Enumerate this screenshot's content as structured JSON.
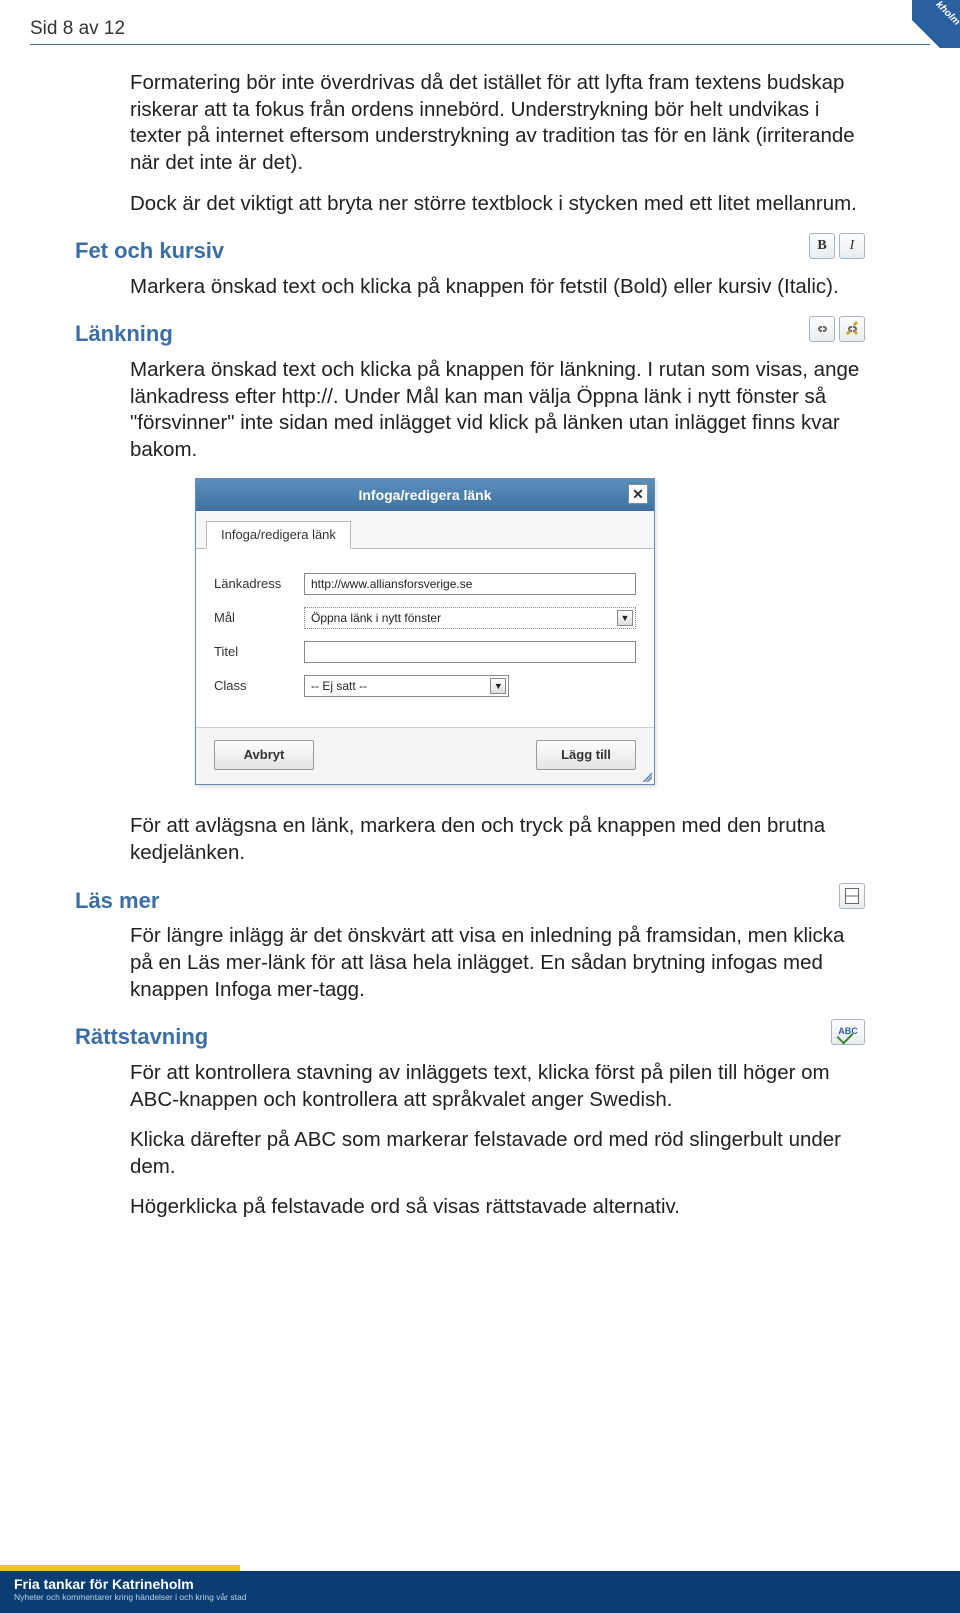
{
  "header": {
    "page_label": "Sid 8 av 12",
    "logo_text": "kholm"
  },
  "paras": {
    "p1": "Formatering bör inte överdrivas då det istället för att lyfta fram textens budskap riskerar att ta fokus från ordens innebörd. Understrykning bör helt undvikas i texter på internet eftersom understrykning av tradition tas för en länk (irriterande när det inte är det).",
    "p2": "Dock är det viktigt att bryta ner större textblock i stycken med ett litet mellanrum.",
    "fetkursiv_h": "Fet och kursiv",
    "fetkursiv_p": "Markera önskad text och klicka på knappen för fetstil (Bold) eller kursiv (Italic).",
    "lankning_h": "Länkning",
    "lankning_p": "Markera önskad text och klicka på knappen för länkning. I rutan som visas, ange länkadress efter http://. Under Mål kan man välja Öppna länk i nytt fönster så \"försvinner\" inte sidan med inlägget vid klick på länken utan inlägget finns kvar bakom.",
    "after_dialog": "För att avlägsna en länk, markera den och tryck på knappen med den brutna kedjelänken.",
    "lasmer_h": "Läs mer",
    "lasmer_p": "För längre inlägg är det önskvärt att visa en inledning på framsidan, men klicka på en Läs mer-länk för att läsa hela inlägget. En sådan brytning infogas med knappen Infoga mer-tagg.",
    "ratt_h": "Rättstavning",
    "ratt_p1": "För att kontrollera stavning av inläggets text, klicka först på pilen till höger om ABC-knappen och kontrollera att språkvalet anger Swedish.",
    "ratt_p2": "Klicka därefter på ABC som markerar felstavade ord med röd slingerbult under dem.",
    "ratt_p3": "Högerklicka på felstavade ord så visas rättstavade alternativ."
  },
  "toolbar": {
    "bold": "B",
    "italic": "I",
    "abc": "ABC"
  },
  "dialog": {
    "title": "Infoga/redigera länk",
    "tab": "Infoga/redigera länk",
    "fields": {
      "url_label": "Länkadress",
      "url_value": "http://www.alliansforsverige.se",
      "target_label": "Mål",
      "target_value": "Öppna länk i nytt fönster",
      "title_label": "Titel",
      "title_value": "",
      "class_label": "Class",
      "class_value": "-- Ej satt --"
    },
    "cancel": "Avbryt",
    "ok": "Lägg till"
  },
  "footer": {
    "line1": "Fria tankar för Katrineholm",
    "line2": "Nyheter och kommentarer kring händelser i och kring vår stad"
  }
}
